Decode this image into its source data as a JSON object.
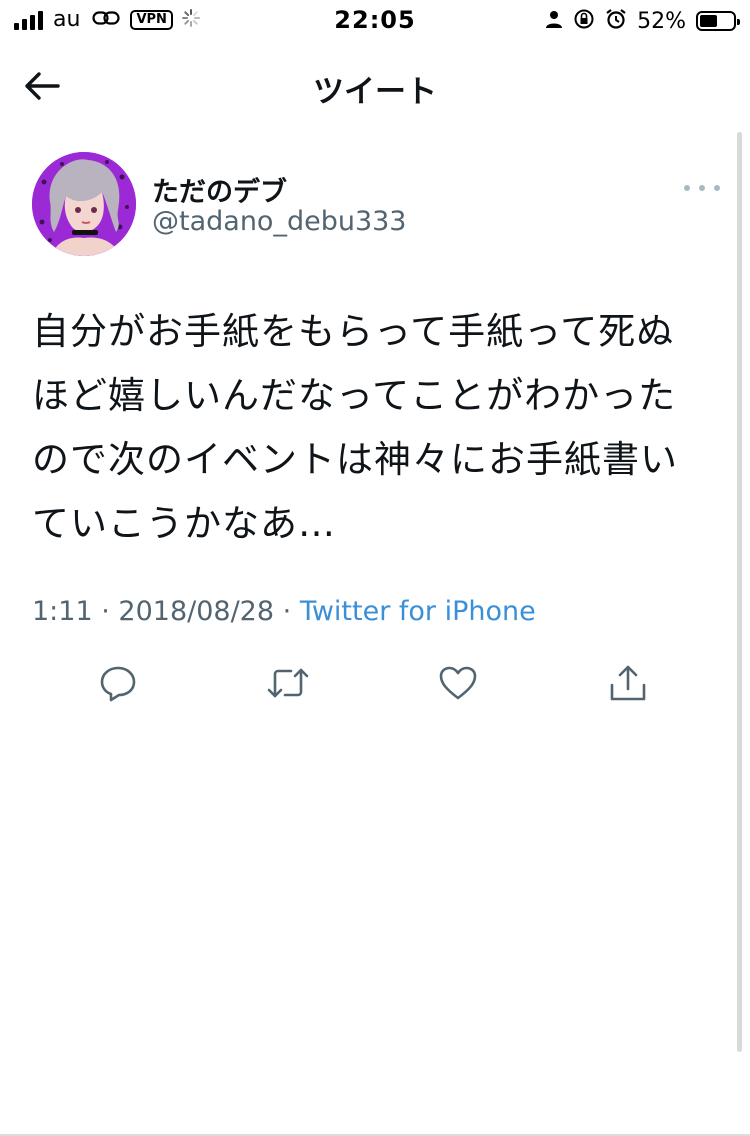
{
  "status_bar": {
    "carrier": "au",
    "vpn": "VPN",
    "time": "22:05",
    "battery_percent": "52%",
    "battery_level": 0.52
  },
  "header": {
    "title": "ツイート",
    "back_icon": "arrow-left-icon"
  },
  "tweet": {
    "display_name": "ただのデブ",
    "handle": "@tadano_debu333",
    "text": "自分がお手紙をもらって手紙って死ぬほど嬉しいんだなってことがわかったので次のイベントは神々にお手紙書いていこうかなあ…",
    "time": "1:11",
    "date": "2018/08/28",
    "separator": "·",
    "source": "Twitter for iPhone",
    "more_icon": "more-dots-icon"
  },
  "actions": [
    {
      "icon": "reply-icon"
    },
    {
      "icon": "retweet-icon"
    },
    {
      "icon": "like-icon"
    },
    {
      "icon": "share-icon"
    }
  ],
  "colors": {
    "text": "#0f1419",
    "secondary": "#536471",
    "link": "#3b8fd6",
    "icon": "#536471",
    "avatar_bg": "#9b2ad6"
  }
}
